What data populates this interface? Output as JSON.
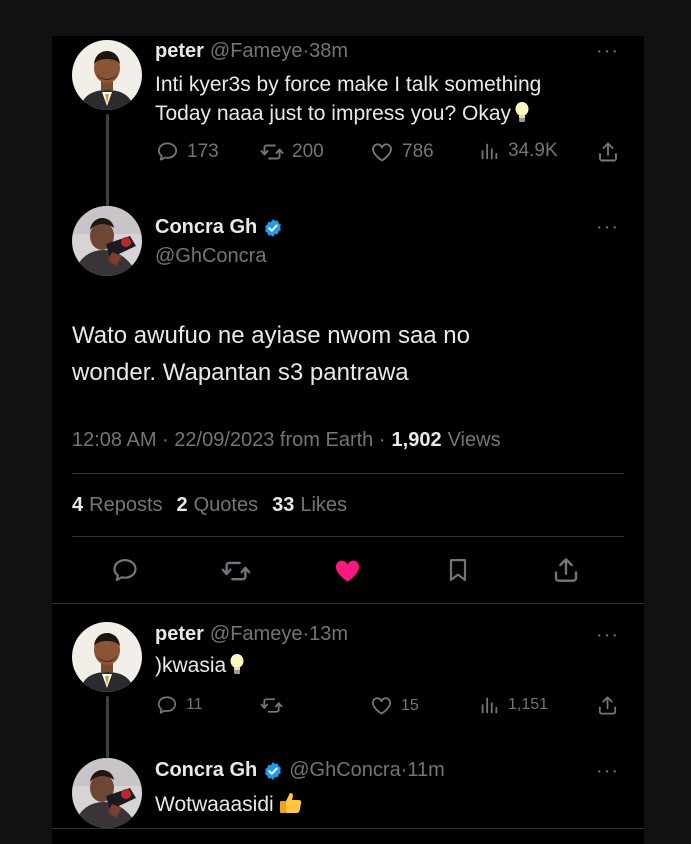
{
  "tweet1": {
    "name": "peter",
    "handle": "@Fameye",
    "time": "38m",
    "line1": "Inti kyer3s by force make I talk something",
    "line2": "Today naaa  just to impress you? Okay",
    "replies": "173",
    "reposts": "200",
    "likes": "786",
    "views": "34.9K"
  },
  "main": {
    "name": "Concra Gh",
    "handle": "@GhConcra",
    "line1": "Wato awufuo ne ayiase nwom saa no",
    "line2": "wonder. Wapantan s3 pantrawa",
    "timestamp": "12:08 AM · 22/09/2023 from Earth ·",
    "views_count": "1,902",
    "views_label": "Views",
    "reposts_count": "4",
    "reposts_label": "Reposts",
    "quotes_count": "2",
    "quotes_label": "Quotes",
    "likes_count": "33",
    "likes_label": "Likes",
    "like_color": "#f91880"
  },
  "reply1": {
    "name": "peter",
    "handle": "@Fameye",
    "time": "13m",
    "text": ")kwasia",
    "replies": "11",
    "likes": "15",
    "views": "1,151"
  },
  "reply2": {
    "name": "Concra Gh",
    "handle": "@GhConcra",
    "time": "11m",
    "text": "Wotwaaasidi"
  },
  "colors": {
    "background": "#000000",
    "text": "#e7e9ea",
    "muted": "#71767b",
    "verified": "#1d9bf0",
    "divider": "#2f3336"
  },
  "icons": [
    "reply-icon",
    "repost-icon",
    "like-icon",
    "views-icon",
    "share-icon",
    "bookmark-icon",
    "verified-icon",
    "more-icon",
    "lightbulb-emoji",
    "thumbs-up-emoji"
  ]
}
